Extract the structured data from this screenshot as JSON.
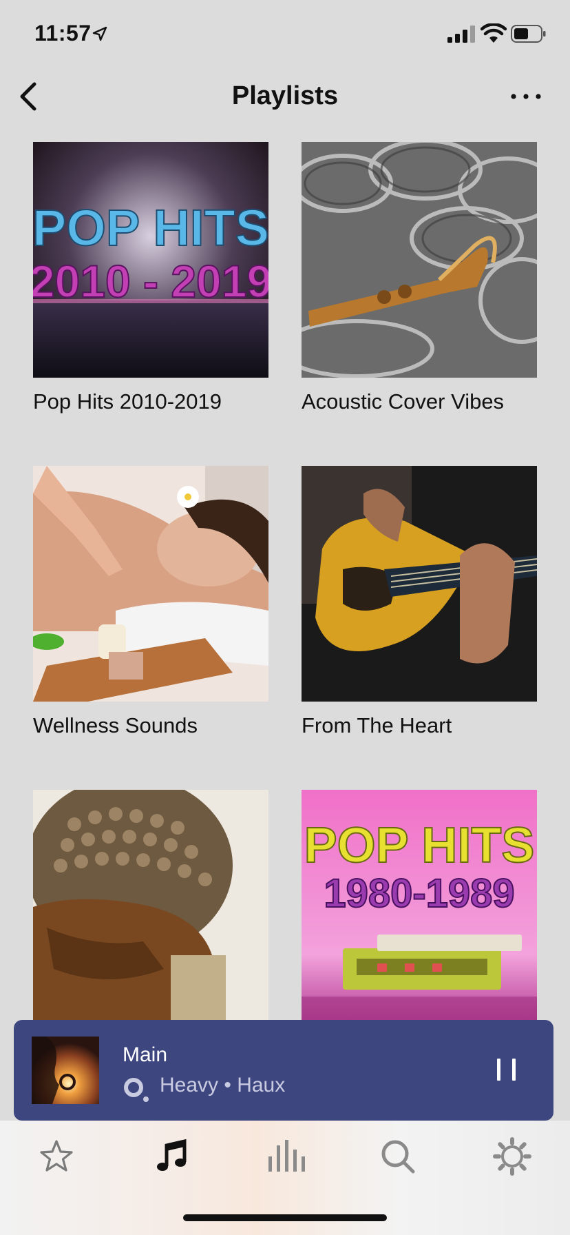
{
  "status_bar": {
    "time": "11:57"
  },
  "nav": {
    "title": "Playlists"
  },
  "playlists": [
    {
      "label": "Pop Hits 2010-2019",
      "art_line1": "POP HITS",
      "art_line2": "2010 - 2019"
    },
    {
      "label": "Acoustic Cover Vibes"
    },
    {
      "label": "Wellness Sounds"
    },
    {
      "label": "From The Heart"
    },
    {
      "label": ""
    },
    {
      "label": "",
      "art_line1": "POP HITS",
      "art_line2": "1980-1989"
    }
  ],
  "player": {
    "title": "Main",
    "subtitle": "Heavy • Haux",
    "accent": "#3e4680"
  },
  "tabbar": {
    "items": [
      {
        "icon": "star-icon"
      },
      {
        "icon": "music-note-icon",
        "selected": true
      },
      {
        "icon": "equalizer-icon"
      },
      {
        "icon": "search-icon"
      },
      {
        "icon": "gear-icon"
      }
    ]
  }
}
